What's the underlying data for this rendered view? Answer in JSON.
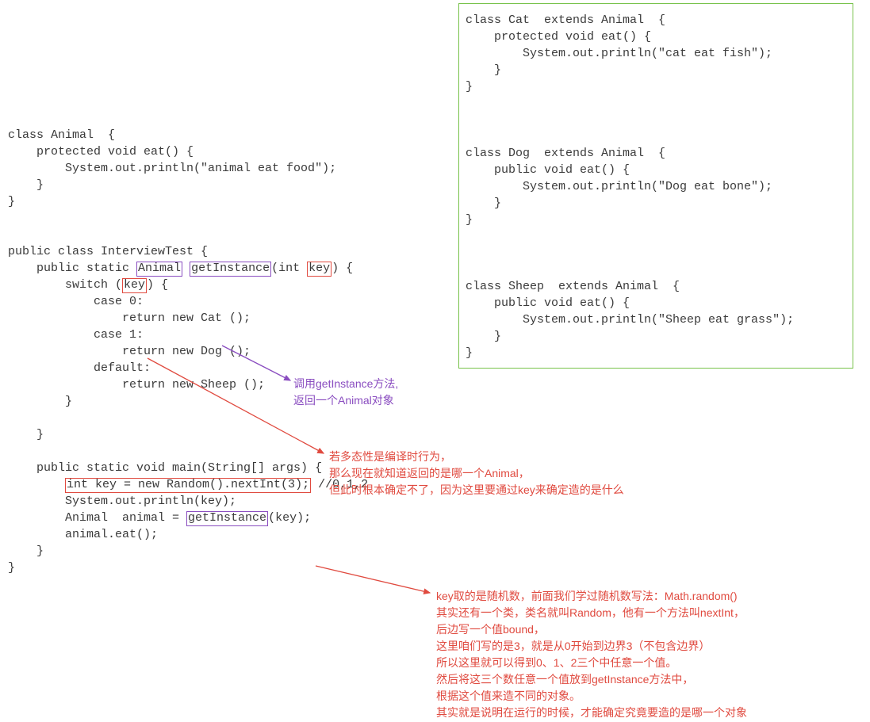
{
  "code_animal": "class Animal  {\n    protected void eat() {\n        System.out.println(\"animal eat food\");\n    }\n}",
  "code_interview_pre1": "public class InterviewTest {\n    public static ",
  "box_animal": "Animal",
  "space1": " ",
  "box_getInstance": "getInstance",
  "code_post_getInstance": "(int ",
  "box_key": "key",
  "code_after_key": ") {",
  "code_switch_line_pre": "        switch (",
  "box_key2": "key",
  "code_switch_line_post": ") {",
  "code_switch_body": "            case 0:\n                return new Cat ();\n            case 1:\n                return new Dog ();\n            default:\n                return new Sheep ();\n        }\n\n    }\n\n    public static void main(String[] args) {",
  "code_random_pre": "        ",
  "box_random": "int key = new Random().nextInt(3);",
  "code_random_post": " //0,1,2",
  "code_main_mid1": "        System.out.println(key);\n",
  "code_animalvar_pre": "        Animal  animal = ",
  "box_getInstance2": "getInstance",
  "code_animalvar_post": "(key);",
  "code_main_end": "        animal.eat();\n    }\n}",
  "green_code": "class Cat  extends Animal  {\n    protected void eat() {\n        System.out.println(\"cat eat fish\");\n    }\n}\n\n\n\nclass Dog  extends Animal  {\n    public void eat() {\n        System.out.println(\"Dog eat bone\");\n    }\n}\n\n\n\nclass Sheep  extends Animal  {\n    public void eat() {\n        System.out.println(\"Sheep eat grass\");\n    }\n}",
  "annot_purple_l1": "调用getInstance方法,",
  "annot_purple_l2": "返回一个Animal对象",
  "annot_red1_l1": "若多态性是编译时行为，",
  "annot_red1_l2": "那么现在就知道返回的是哪一个Animal，",
  "annot_red1_l3": "但此时根本确定不了，因为这里要通过key来确定造的是什么",
  "annot_red2_l1": "key取的是随机数，前面我们学过随机数写法：Math.random()",
  "annot_red2_l2": "其实还有一个类，类名就叫Random，他有一个方法叫nextInt，",
  "annot_red2_l3": "后边写一个值bound，",
  "annot_red2_l4": "这里咱们写的是3，就是从0开始到边界3（不包含边界）",
  "annot_red2_l5": "所以这里就可以得到0、1、2三个中任意一个值。",
  "annot_red2_l6": "然后将这三个数任意一个值放到getInstance方法中，",
  "annot_red2_l7": "根据这个值来造不同的对象。",
  "annot_red2_l8": "其实就是说明在运行的时候，才能确定究竟要造的是哪一个对象"
}
